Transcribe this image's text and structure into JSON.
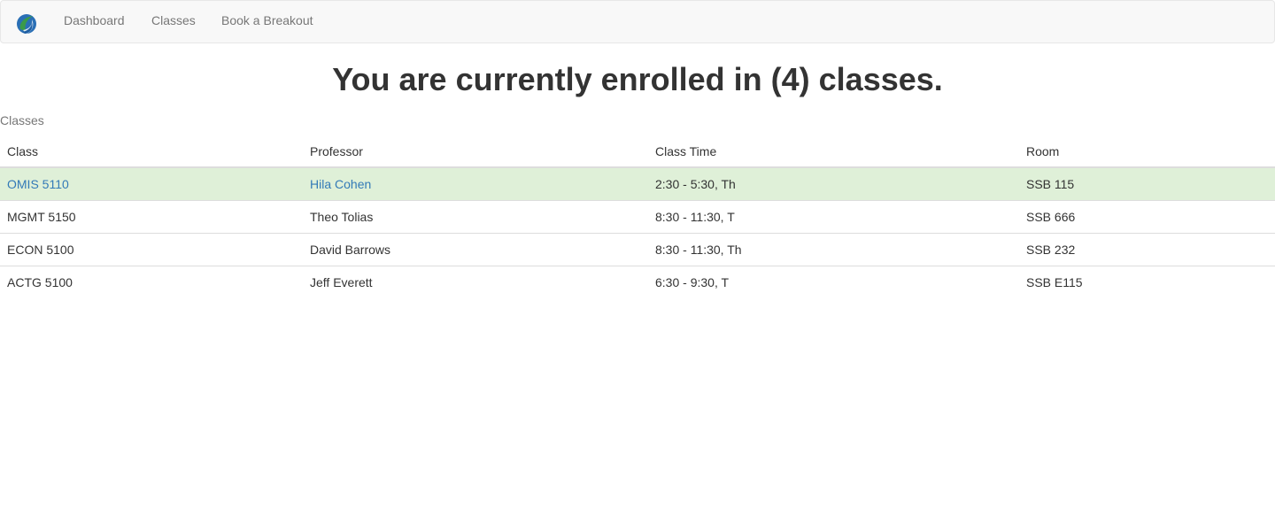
{
  "navbar": {
    "brand_icon": "s-logo-icon",
    "brand_colors": {
      "green": "#3a9a4a",
      "blue": "#1f5fa3"
    },
    "links": [
      "Dashboard",
      "Classes",
      "Book a Breakout"
    ]
  },
  "page": {
    "title": "You are currently enrolled in (4) classes.",
    "table_caption": "Classes"
  },
  "table": {
    "headers": [
      "Class",
      "Professor",
      "Class Time",
      "Room"
    ],
    "rows": [
      {
        "class": "OMIS 5110",
        "professor": "Hila Cohen",
        "time": "2:30 - 5:30, Th",
        "room": "SSB 115",
        "highlighted": true
      },
      {
        "class": "MGMT 5150",
        "professor": "Theo Tolias",
        "time": "8:30 - 11:30, T",
        "room": "SSB 666",
        "highlighted": false
      },
      {
        "class": "ECON 5100",
        "professor": "David Barrows",
        "time": "8:30 - 11:30, Th",
        "room": "SSB 232",
        "highlighted": false
      },
      {
        "class": "ACTG 5100",
        "professor": "Jeff Everett",
        "time": "6:30 - 9:30, T",
        "room": "SSB E115",
        "highlighted": false
      }
    ],
    "colors": {
      "highlight_row": "#dff0d8",
      "link": "#337ab7",
      "border": "#dddddd"
    }
  }
}
